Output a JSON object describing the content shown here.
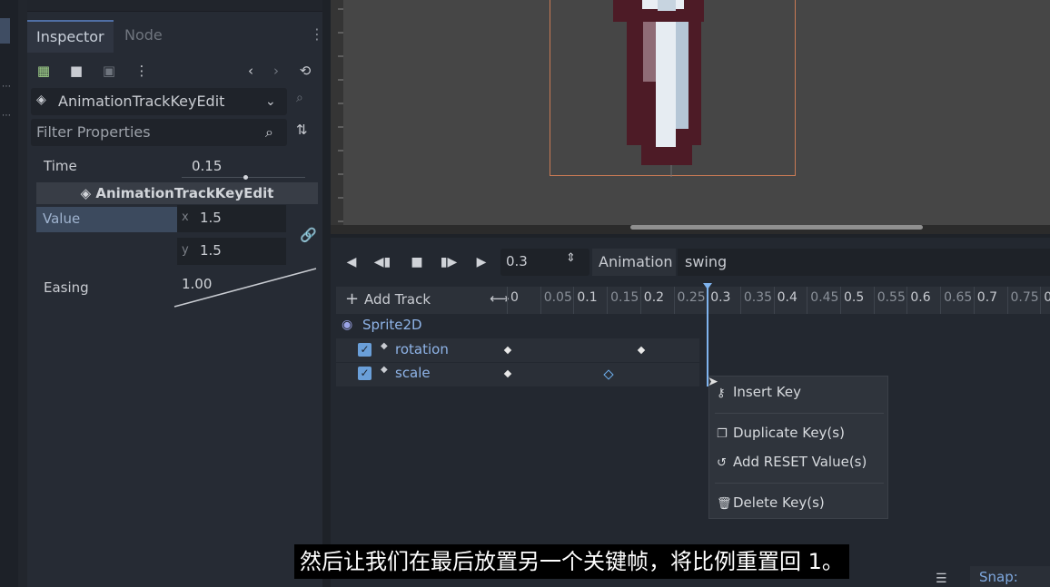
{
  "inspector": {
    "tabs": [
      "Inspector",
      "Node"
    ],
    "class_name": "AnimationTrackKeyEdit",
    "filter_placeholder": "Filter Properties",
    "time_label": "Time",
    "time_value": "0.15",
    "section_title": "AnimationTrackKeyEdit",
    "value_label": "Value",
    "x_label": "x",
    "x_value": "1.5",
    "y_label": "y",
    "y_value": "1.5",
    "easing_label": "Easing",
    "easing_value": "1.00"
  },
  "animation": {
    "time_value": "0.3",
    "animation_label": "Animation",
    "animation_name": "swing",
    "add_track_label": "Add Track",
    "ticks": [
      "0",
      "0.05",
      "0.1",
      "0.15",
      "0.2",
      "0.25",
      "0.3",
      "0.35",
      "0.4",
      "0.45",
      "0.5",
      "0.55",
      "0.6",
      "0.65",
      "0.7",
      "0.75",
      "0"
    ],
    "node_name": "Sprite2D",
    "tracks": [
      {
        "name": "rotation",
        "keys": [
          0,
          0.2
        ]
      },
      {
        "name": "scale",
        "keys": [
          0,
          0.15
        ]
      }
    ],
    "playhead_time": 0.3
  },
  "context_menu": {
    "insert_key": "Insert Key",
    "duplicate_keys": "Duplicate Key(s)",
    "add_reset": "Add RESET Value(s)",
    "delete_keys": "Delete Key(s)"
  },
  "subtitle": "然后让我们在最后放置另一个关键帧，将比例重置回 1。",
  "snap_label": "Snap:"
}
